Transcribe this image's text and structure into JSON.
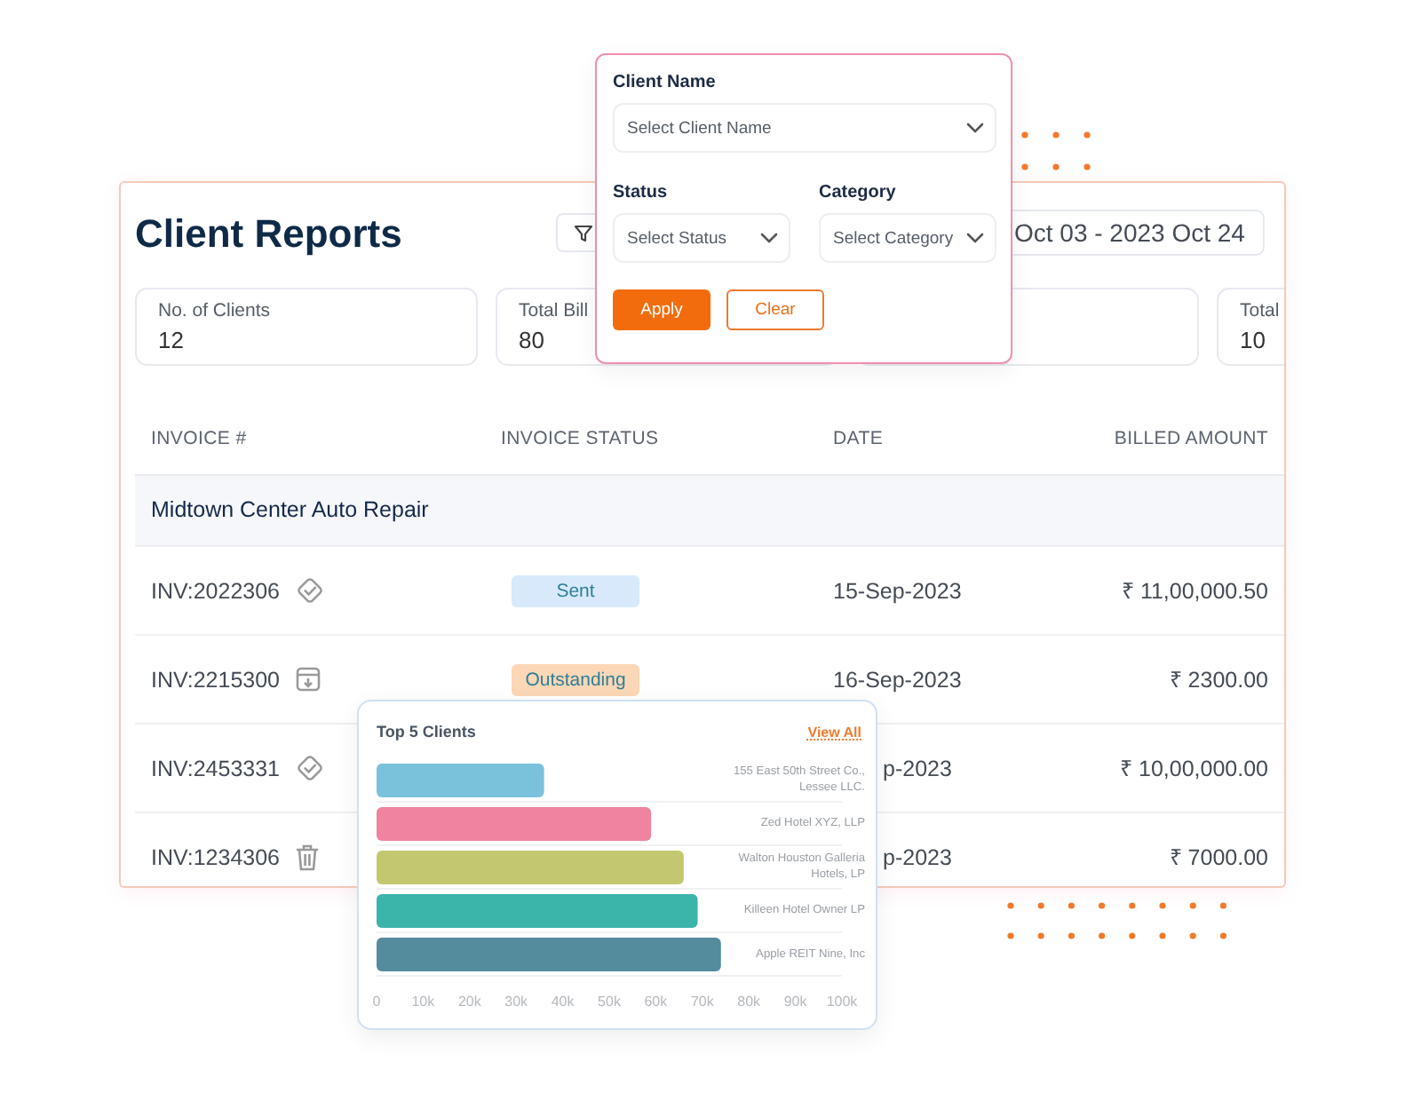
{
  "report": {
    "title": "Client Reports",
    "date_range": "Oct 03 - 2023 Oct 24",
    "stats": [
      {
        "kind": "stat",
        "label": "No. of Clients",
        "value": "12"
      },
      {
        "kind": "stat",
        "label": "Total Bill",
        "value": "80"
      },
      {
        "kind": "blank"
      },
      {
        "kind": "stat",
        "label": "Total",
        "value": "10"
      }
    ],
    "columns": [
      "INVOICE #",
      "INVOICE STATUS",
      "DATE",
      "BILLED AMOUNT"
    ],
    "group": "Midtown Center Auto Repair",
    "rows": [
      {
        "invoice": "INV:2022306",
        "kind": "verified",
        "status": {
          "label": "Sent",
          "color": "#d8e9fb"
        },
        "date": "15-Sep-2023",
        "amount": "₹ 11,00,000.50"
      },
      {
        "invoice": "INV:2215300",
        "kind": "archive",
        "status": {
          "label": "Outstanding",
          "color": "#fcd7b6"
        },
        "date": "16-Sep-2023",
        "amount": "₹ 2300.00"
      },
      {
        "invoice": "INV:2453331",
        "kind": "verified",
        "date": "p-2023",
        "amount": "₹ 10,00,000.00"
      },
      {
        "invoice": "INV:1234306",
        "kind": "delete",
        "date": "p-2023",
        "amount": "₹ 7000.00"
      }
    ]
  },
  "filter": {
    "fields": [
      {
        "label": "Client Name",
        "placeholder": "Select Client Name"
      },
      {
        "label": "Status",
        "placeholder": "Select Status"
      },
      {
        "label": "Category",
        "placeholder": "Select Category"
      }
    ],
    "buttons": [
      {
        "label": "Apply",
        "kind": "primary"
      },
      {
        "label": "Clear",
        "kind": "secondary"
      }
    ]
  },
  "top_clients": {
    "title": "Top 5 Clients",
    "link": "View All",
    "chart_data": {
      "type": "bar",
      "orientation": "horizontal",
      "stacked": true,
      "grid": true,
      "series": [
        {
          "name": "155 East 50th Street Co., Lessee LLC.",
          "color": "#7ac1dc",
          "values": [
            36000,
            null,
            null,
            null,
            null
          ]
        },
        {
          "name": "Zed Hotel XYZ, LLP",
          "color": "#ef83a0",
          "values": [
            null,
            59000,
            null,
            null,
            null
          ]
        },
        {
          "name": "Walton Houston Galleria Hotels, LP",
          "color": "#c3c870",
          "values": [
            null,
            null,
            66000,
            null,
            null
          ]
        },
        {
          "name": "Killeen Hotel Owner LP",
          "color": "#3bb4aa",
          "values": [
            null,
            null,
            null,
            69000,
            null
          ]
        },
        {
          "name": "Apple REIT Nine, Inc",
          "color": "#548b9d",
          "values": [
            null,
            null,
            null,
            null,
            74000
          ]
        }
      ],
      "xlim": [
        0,
        100000
      ],
      "xticks": [
        {
          "value": 0,
          "label": "0"
        },
        {
          "value": 10000,
          "label": "10k"
        },
        {
          "value": 20000,
          "label": "20k"
        },
        {
          "value": 30000,
          "label": "30k"
        },
        {
          "value": 40000,
          "label": "40k"
        },
        {
          "value": 50000,
          "label": "50k"
        },
        {
          "value": 60000,
          "label": "60k"
        },
        {
          "value": 70000,
          "label": "70k"
        },
        {
          "value": 80000,
          "label": "80k"
        },
        {
          "value": 90000,
          "label": "90k"
        },
        {
          "value": 100000,
          "label": "100k"
        }
      ]
    }
  }
}
